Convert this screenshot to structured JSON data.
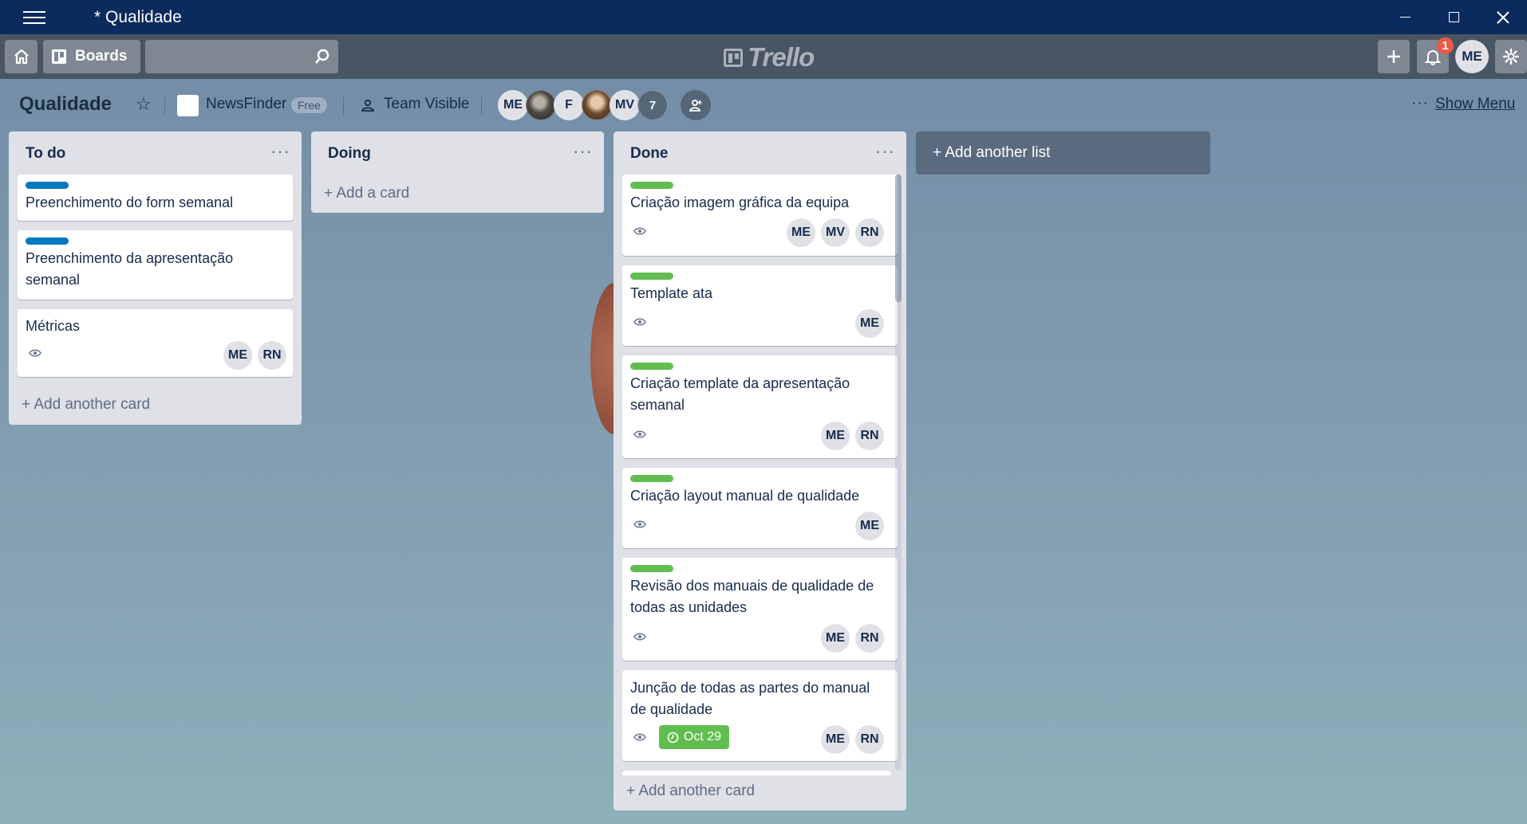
{
  "window": {
    "title": "* Qualidade"
  },
  "appbar": {
    "boards_label": "Boards",
    "search_value": "",
    "logo_text": "Trello",
    "notifications_count": "1",
    "user_initials": "ME"
  },
  "board": {
    "name": "Qualidade",
    "team_name": "NewsFinder",
    "team_plan": "Free",
    "visibility": "Team Visible",
    "members": [
      "ME",
      "",
      "F",
      "",
      "MV"
    ],
    "members_more": "7",
    "show_menu": "Show Menu",
    "menu_dots": "···"
  },
  "lists": [
    {
      "title": "To do",
      "add_label": "+ Add another card",
      "cards": [
        {
          "label": "blue",
          "title": "Preenchimento do form semanal",
          "members": []
        },
        {
          "label": "blue",
          "title": "Preenchimento da apresentação semanal",
          "members": []
        },
        {
          "label": null,
          "title": "Métricas",
          "watching": true,
          "members": [
            "ME",
            "RN"
          ]
        }
      ]
    },
    {
      "title": "Doing",
      "add_label": "+ Add a card",
      "cards": []
    },
    {
      "title": "Done",
      "add_label": "+ Add another card",
      "cards": [
        {
          "label": "green",
          "title": "Criação imagem gráfica da equipa",
          "watching": true,
          "members": [
            "ME",
            "MV",
            "RN"
          ]
        },
        {
          "label": "green",
          "title": "Template ata",
          "watching": true,
          "members": [
            "ME"
          ]
        },
        {
          "label": "green",
          "title": "Criação template da apresentação semanal",
          "watching": true,
          "members": [
            "ME",
            "RN"
          ]
        },
        {
          "label": "green",
          "title": "Criação layout manual de qualidade",
          "watching": true,
          "members": [
            "ME"
          ]
        },
        {
          "label": "green",
          "title": "Revisão dos manuais de qualidade de todas as unidades",
          "watching": true,
          "members": [
            "ME",
            "RN"
          ]
        },
        {
          "label": null,
          "title": "Junção de todas as partes do manual de qualidade",
          "watching": true,
          "due": "Oct 29",
          "members": [
            "ME",
            "RN"
          ]
        }
      ]
    }
  ],
  "add_list_label": "+ Add another list",
  "list_menu_dots": "···",
  "colors": {
    "label_blue": "#0079bf",
    "label_green": "#61bd4f",
    "titlebar": "#0b2a5e"
  }
}
